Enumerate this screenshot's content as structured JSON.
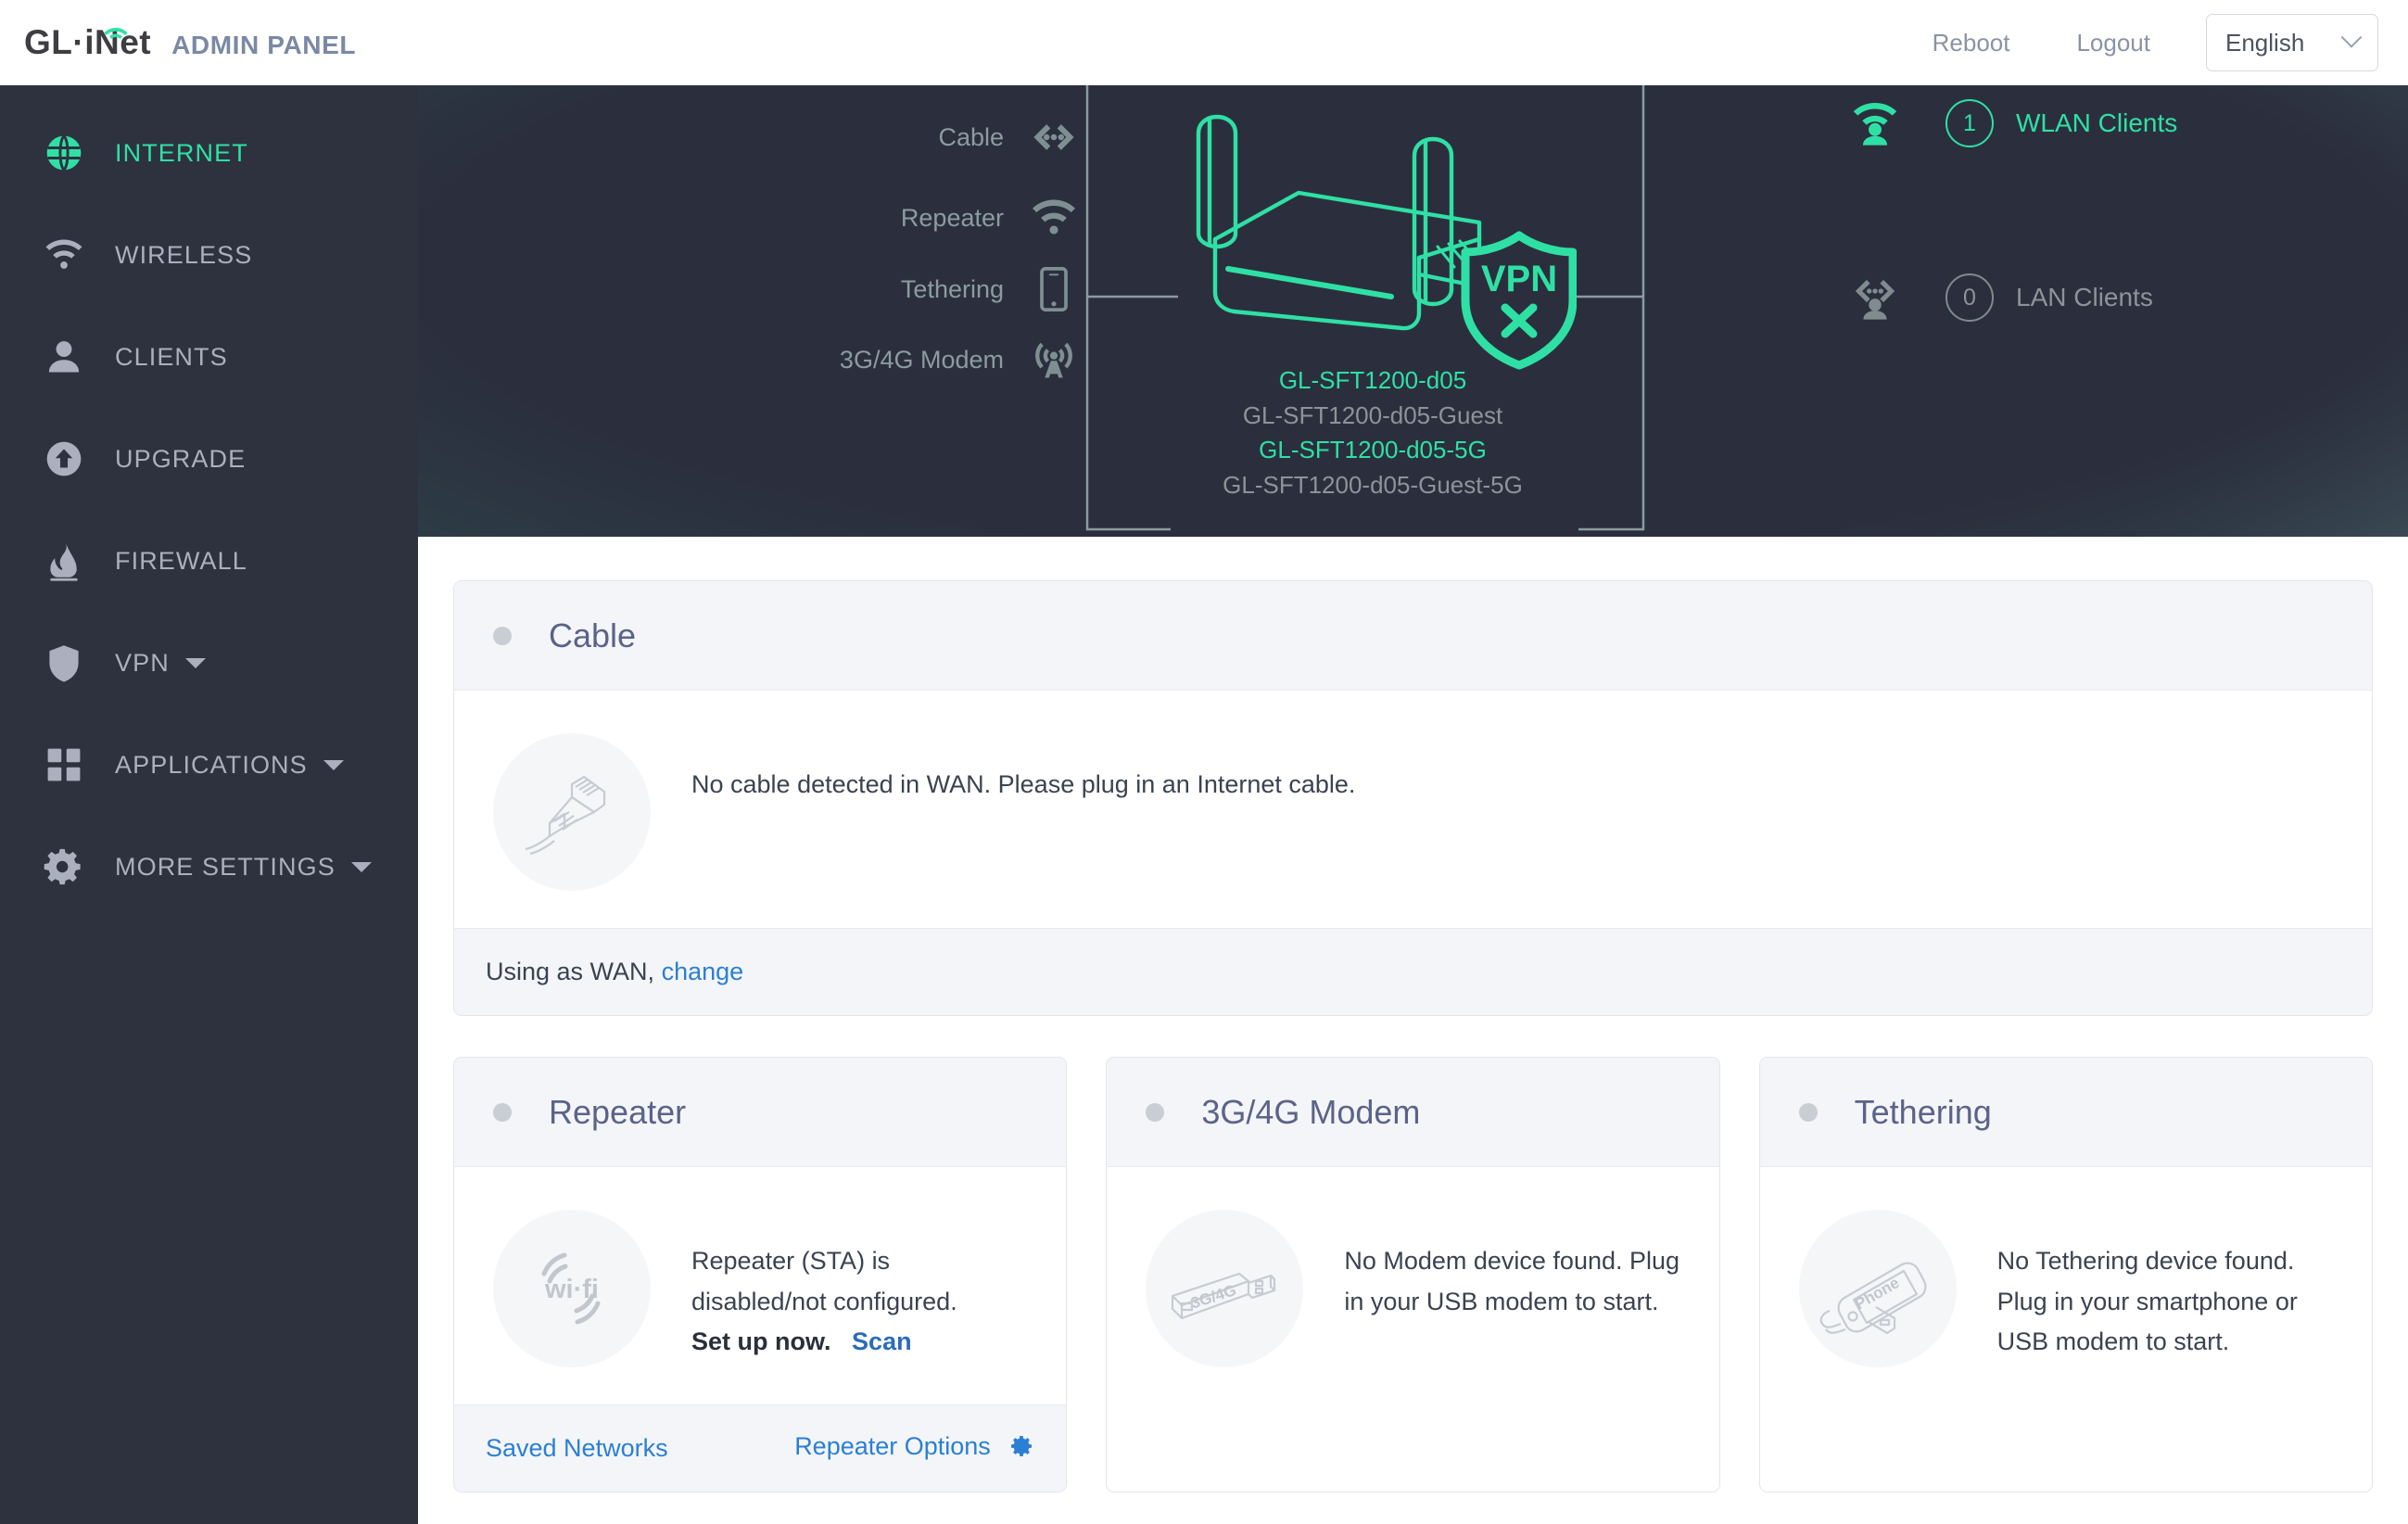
{
  "header": {
    "brand_primary": "GL·iNet",
    "brand_secondary": "ADMIN PANEL",
    "reboot_label": "Reboot",
    "logout_label": "Logout",
    "language_value": "English"
  },
  "sidebar": {
    "items": [
      {
        "label": "INTERNET",
        "icon": "globe-icon",
        "active": true,
        "expandable": false
      },
      {
        "label": "WIRELESS",
        "icon": "wifi-icon",
        "active": false,
        "expandable": false
      },
      {
        "label": "CLIENTS",
        "icon": "user-icon",
        "active": false,
        "expandable": false
      },
      {
        "label": "UPGRADE",
        "icon": "upload-icon",
        "active": false,
        "expandable": false
      },
      {
        "label": "FIREWALL",
        "icon": "flame-icon",
        "active": false,
        "expandable": false
      },
      {
        "label": "VPN",
        "icon": "shield-icon",
        "active": false,
        "expandable": true
      },
      {
        "label": "APPLICATIONS",
        "icon": "grid-icon",
        "active": false,
        "expandable": true
      },
      {
        "label": "MORE SETTINGS",
        "icon": "gear-icon",
        "active": false,
        "expandable": true
      }
    ]
  },
  "hero": {
    "wan_sources": [
      {
        "label": "Cable",
        "icon": "lan-icon"
      },
      {
        "label": "Repeater",
        "icon": "wifi-icon"
      },
      {
        "label": "Tethering",
        "icon": "phone-icon"
      },
      {
        "label": "3G/4G Modem",
        "icon": "cell-tower-icon"
      }
    ],
    "router": {
      "vpn_badge_label": "VPN",
      "vpn_status": "disconnected"
    },
    "ssids": [
      {
        "name": "GL-SFT1200-d05",
        "active": true
      },
      {
        "name": "GL-SFT1200-d05-Guest",
        "active": false
      },
      {
        "name": "GL-SFT1200-d05-5G",
        "active": true
      },
      {
        "name": "GL-SFT1200-d05-Guest-5G",
        "active": false
      }
    ],
    "clients": [
      {
        "count": "1",
        "label": "WLAN Clients",
        "icon": "wlan-client-icon",
        "active": true
      },
      {
        "count": "0",
        "label": "LAN Clients",
        "icon": "lan-client-icon",
        "active": false
      }
    ]
  },
  "cards": {
    "cable": {
      "title": "Cable",
      "status": "inactive",
      "icon": "ethernet-cable-icon",
      "message": "No cable detected in WAN. Please plug in an Internet cable.",
      "footer_text": "Using as WAN,",
      "footer_link": "change"
    },
    "repeater": {
      "title": "Repeater",
      "status": "inactive",
      "icon": "wifi-logo-icon",
      "message_line1": "Repeater (STA) is",
      "message_line2": "disabled/not configured.",
      "cta_text": "Set up now.",
      "cta_link": "Scan",
      "footer_left_link": "Saved Networks",
      "footer_right_link": "Repeater Options"
    },
    "modem": {
      "title": "3G/4G Modem",
      "status": "inactive",
      "icon": "usb-modem-icon",
      "icon_label": "3G/4G",
      "message": "No Modem device found. Plug in your USB modem to start."
    },
    "tethering": {
      "title": "Tethering",
      "status": "inactive",
      "icon": "phone-usb-icon",
      "icon_label": "Phone",
      "message": "No Tethering device found. Plug in your smartphone or USB modem to start."
    }
  },
  "colors": {
    "accent_green": "#2fe0a5",
    "link_blue": "#2b7fd4",
    "sidebar_bg": "#2e323f",
    "hero_dark": "#2b2f3d",
    "card_title": "#5c6389"
  }
}
